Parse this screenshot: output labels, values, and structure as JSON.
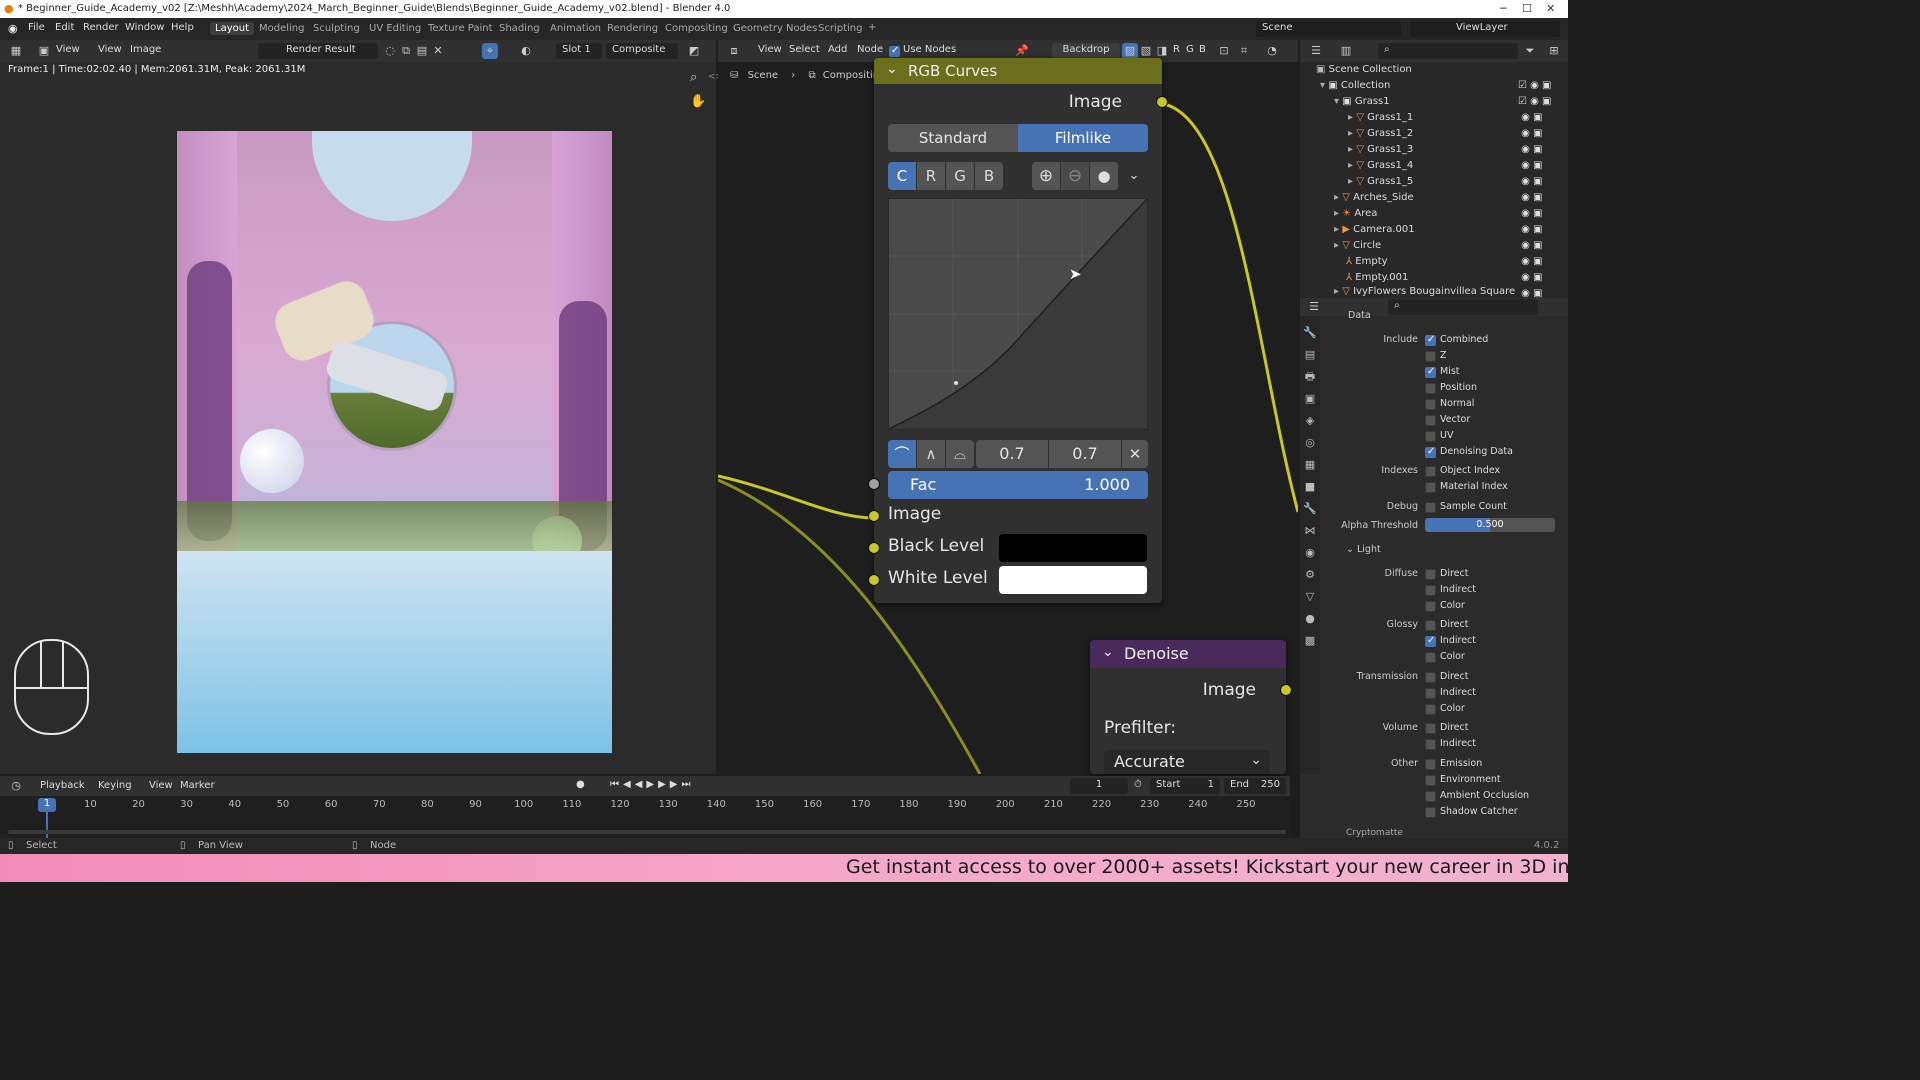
{
  "window": {
    "title": "* Beginner_Guide_Academy_v02 [Z:\\Meshh\\Academy\\2024_March_Beginner_Guide\\Blends\\Beginner_Guide_Academy_v02.blend] - Blender 4.0"
  },
  "menu": [
    "File",
    "Edit",
    "Render",
    "Window",
    "Help"
  ],
  "workspaces": [
    "Layout",
    "Modeling",
    "Sculpting",
    "UV Editing",
    "Texture Paint",
    "Shading",
    "Animation",
    "Rendering",
    "Compositing",
    "Geometry Nodes",
    "Scripting"
  ],
  "topright": {
    "scene": "Scene",
    "viewlayer": "ViewLayer"
  },
  "image_header": {
    "view1": "View",
    "view2": "View",
    "image": "Image",
    "render_result": "Render Result",
    "slot": "Slot 1",
    "composite": "Composite"
  },
  "render_info": "Frame:1 | Time:02:02.40 | Mem:2061.31M, Peak: 2061.31M",
  "node_header": {
    "view": "View",
    "select": "Select",
    "add": "Add",
    "node": "Node",
    "use_nodes": "Use Nodes",
    "backdrop": "Backdrop",
    "r": "R",
    "g": "G",
    "b": "B"
  },
  "breadcrumb": {
    "scene": "Scene",
    "tree": "Compositing Nodetree"
  },
  "rgb_curves": {
    "title": "RGB Curves",
    "output": "Image",
    "modes": [
      "Standard",
      "Filmlike"
    ],
    "channels": [
      "C",
      "R",
      "G",
      "B"
    ],
    "point_x": "0.7",
    "point_y": "0.7",
    "fac_label": "Fac",
    "fac_value": "1.000",
    "inputs": [
      "Image",
      "Black Level",
      "White Level"
    ]
  },
  "denoise": {
    "title": "Denoise",
    "output": "Image",
    "prefilter_label": "Prefilter:",
    "prefilter_value": "Accurate"
  },
  "outliner": {
    "rows": [
      {
        "label": "Scene Collection"
      },
      {
        "label": "Collection"
      },
      {
        "label": "Grass1"
      },
      {
        "label": "Grass1_1"
      },
      {
        "label": "Grass1_2"
      },
      {
        "label": "Grass1_3"
      },
      {
        "label": "Grass1_4"
      },
      {
        "label": "Grass1_5"
      },
      {
        "label": "Arches_Side"
      },
      {
        "label": "Area"
      },
      {
        "label": "Camera.001"
      },
      {
        "label": "Circle"
      },
      {
        "label": "Empty"
      },
      {
        "label": "Empty.001"
      },
      {
        "label": "IvyFlowers Bougainvillea Square"
      }
    ]
  },
  "properties": {
    "section": "Data",
    "include_label": "Include",
    "include": [
      {
        "l": "Combined",
        "on": true
      },
      {
        "l": "Z",
        "on": false
      },
      {
        "l": "Mist",
        "on": true
      },
      {
        "l": "Position",
        "on": false
      },
      {
        "l": "Normal",
        "on": false
      },
      {
        "l": "Vector",
        "on": false
      },
      {
        "l": "UV",
        "on": false
      },
      {
        "l": "Denoising Data",
        "on": true
      }
    ],
    "indexes_label": "Indexes",
    "indexes": [
      {
        "l": "Object Index",
        "on": false
      },
      {
        "l": "Material Index",
        "on": false
      }
    ],
    "debug_label": "Debug",
    "debug": "Sample Count",
    "alpha_label": "Alpha Threshold",
    "alpha_value": "0.500",
    "light_section": "Light",
    "diffuse_label": "Diffuse",
    "diffuse": [
      {
        "l": "Direct",
        "on": false
      },
      {
        "l": "Indirect",
        "on": false
      },
      {
        "l": "Color",
        "on": false
      }
    ],
    "glossy_label": "Glossy",
    "glossy": [
      {
        "l": "Direct",
        "on": false
      },
      {
        "l": "Indirect",
        "on": true
      },
      {
        "l": "Color",
        "on": false
      }
    ],
    "transmission_label": "Transmission",
    "transmission": [
      {
        "l": "Direct",
        "on": false
      },
      {
        "l": "Indirect",
        "on": false
      },
      {
        "l": "Color",
        "on": false
      }
    ],
    "volume_label": "Volume",
    "volume": [
      {
        "l": "Direct",
        "on": false
      },
      {
        "l": "Indirect",
        "on": false
      }
    ],
    "other_label": "Other",
    "other": [
      {
        "l": "Emission",
        "on": false
      },
      {
        "l": "Environment",
        "on": false
      },
      {
        "l": "Ambient Occlusion",
        "on": false
      },
      {
        "l": "Shadow Catcher",
        "on": false
      }
    ],
    "next_section": "Cryptomatte"
  },
  "timeline": {
    "menus": [
      "Playback",
      "Keying",
      "View",
      "Marker"
    ],
    "current_frame": "1",
    "start_label": "Start",
    "start": "1",
    "end_label": "End",
    "end": "250",
    "ticks": [
      "1",
      "10",
      "20",
      "30",
      "40",
      "50",
      "60",
      "70",
      "80",
      "90",
      "100",
      "110",
      "120",
      "130",
      "140",
      "150",
      "160",
      "170",
      "180",
      "190",
      "200",
      "210",
      "220",
      "230",
      "240",
      "250"
    ]
  },
  "status": {
    "select": "Select",
    "pan": "Pan View",
    "node": "Node",
    "version": "4.0.2"
  },
  "banner": "Get instant access to over 2000+ assets! Kickstart your new career in 3D in",
  "colors": {
    "accent": "#4772b3",
    "socket": "#c7c729",
    "rgb_header": "#6b6f1d",
    "denoise_header": "#4a2a5a",
    "banner": "#f28bb8"
  }
}
